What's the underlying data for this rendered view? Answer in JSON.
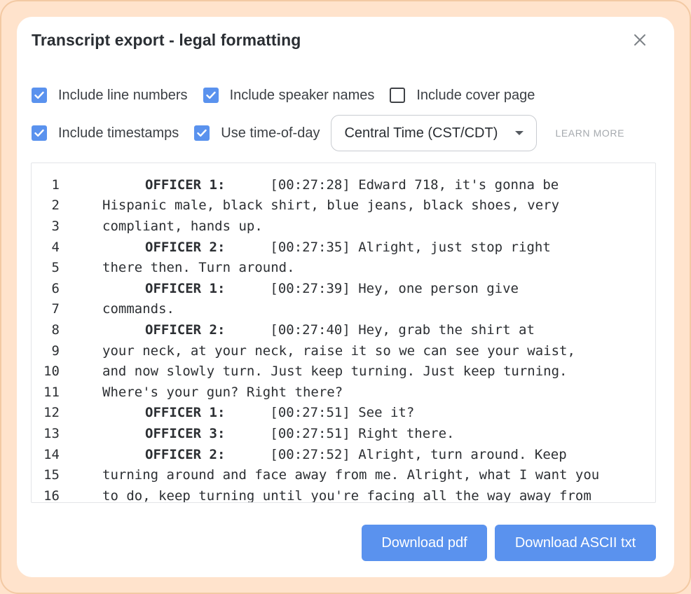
{
  "modal": {
    "title": "Transcript export - legal formatting",
    "close_icon": "close-icon"
  },
  "options": {
    "row1": [
      {
        "label": "Include line numbers",
        "checked": true
      },
      {
        "label": "Include speaker names",
        "checked": true
      },
      {
        "label": "Include cover page",
        "checked": false
      }
    ],
    "row2": [
      {
        "label": "Include timestamps",
        "checked": true
      },
      {
        "label": "Use time-of-day",
        "checked": true
      }
    ],
    "timezone": "Central Time (CST/CDT)",
    "learn_more": "LEARN MORE"
  },
  "transcript": [
    {
      "n": "1",
      "speaker": "OFFICER 1:",
      "text": "[00:27:28] Edward 718, it's gonna be"
    },
    {
      "n": "2",
      "text": "Hispanic male, black shirt, blue jeans, black shoes, very"
    },
    {
      "n": "3",
      "text": "compliant, hands up."
    },
    {
      "n": "4",
      "speaker": "OFFICER 2:",
      "text": "[00:27:35] Alright, just stop right"
    },
    {
      "n": "5",
      "text": "there then. Turn around."
    },
    {
      "n": "6",
      "speaker": "OFFICER 1:",
      "text": "[00:27:39] Hey, one person give"
    },
    {
      "n": "7",
      "text": "commands."
    },
    {
      "n": "8",
      "speaker": "OFFICER 2:",
      "text": "[00:27:40] Hey, grab the shirt at"
    },
    {
      "n": "9",
      "text": "your neck, at your neck, raise it so we can see your waist,"
    },
    {
      "n": "10",
      "text": "and now slowly turn. Just keep turning. Just keep turning."
    },
    {
      "n": "11",
      "text": "Where's your gun? Right there?"
    },
    {
      "n": "12",
      "speaker": "OFFICER 1:",
      "text": "[00:27:51] See it?"
    },
    {
      "n": "13",
      "speaker": "OFFICER 3:",
      "text": "[00:27:51] Right there."
    },
    {
      "n": "14",
      "speaker": "OFFICER 2:",
      "text": "[00:27:52] Alright, turn around. Keep"
    },
    {
      "n": "15",
      "text": "turning around and face away from me. Alright, what I want you"
    },
    {
      "n": "16",
      "text": "to do, keep turning until you're facing all the way away from"
    }
  ],
  "buttons": {
    "download_pdf": "Download pdf",
    "download_txt": "Download ASCII txt"
  },
  "colors": {
    "accent": "#5a92ee",
    "background": "#ffe3cc"
  }
}
